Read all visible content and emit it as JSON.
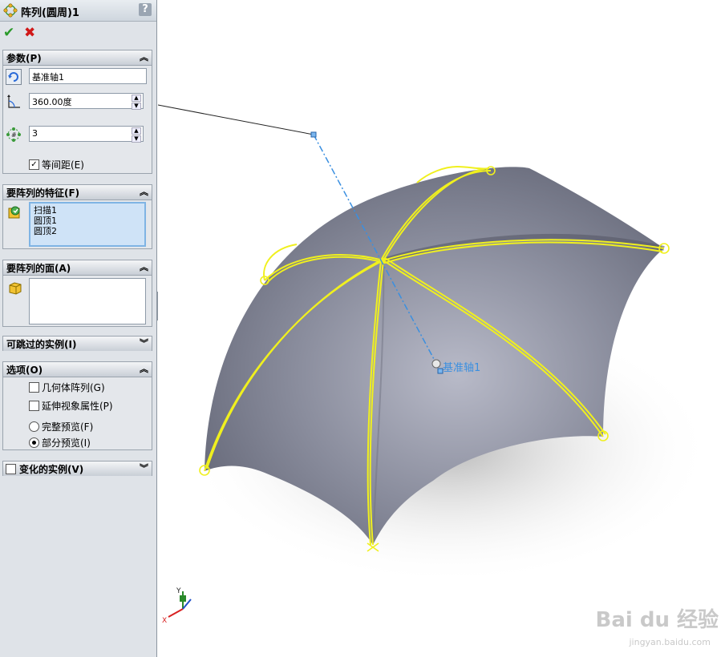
{
  "title": "阵列(圆周)1",
  "help": "?",
  "ok_icon": "check-icon",
  "cancel_icon": "x-icon",
  "params": {
    "header": "参数(P)",
    "axis_value": "基准轴1",
    "angle_value": "360.00度",
    "count_value": "3",
    "equal_spacing_label": "等间距(E)",
    "equal_spacing_checked": true
  },
  "features": {
    "header": "要阵列的特征(F)",
    "items": [
      "扫描1",
      "圆顶1",
      "圆顶2"
    ]
  },
  "faces": {
    "header": "要阵列的面(A)"
  },
  "skip": {
    "header": "可跳过的实例(I)"
  },
  "options": {
    "header": "选项(O)",
    "geometry_pattern": "几何体阵列(G)",
    "propagate_visual": "延伸视象属性(P)",
    "full_preview": "完整预览(F)",
    "partial_preview": "部分预览(I)",
    "selected_preview": "partial"
  },
  "vary": {
    "header": "变化的实例(V)"
  },
  "viewport": {
    "axis_label": "基准轴1",
    "triad_x": "X",
    "triad_y": "Y"
  },
  "watermark": {
    "brand": "Bai du 经验",
    "url": "jingyan.baidu.com"
  },
  "colors": {
    "sketch_yellow": "#f0f01e",
    "axis_blue": "#3a8fe0",
    "model_gray": "#7c7f8e"
  }
}
